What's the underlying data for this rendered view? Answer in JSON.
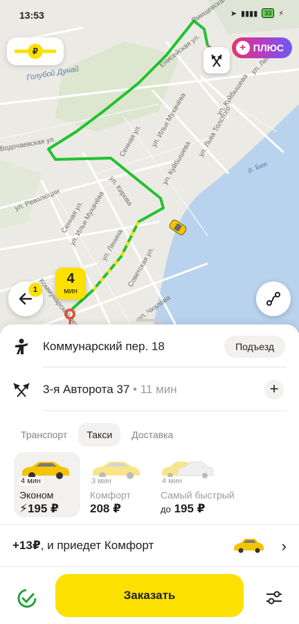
{
  "status_bar": {
    "time": "13:53",
    "battery": "33"
  },
  "map": {
    "district": "Голубой Дунай",
    "river": "р. Бия",
    "streets": [
      "Ямищевская ул.",
      "Енисейская ул.",
      "Водочаевская ул.",
      "ул. Революции",
      "Сенная ул.",
      "ул. Ильи Мухачёва",
      "ул. Куйбышева",
      "ул. Льва Толстого",
      "ул. Кирова",
      "Советская ул.",
      "ул. Ленина",
      "ул. Чкалова",
      "Коммунарский пер.",
      "ул. Ильи Мухачёва",
      "Сенная ул.",
      "ул. Ленина",
      "ул. Куйбышева"
    ],
    "plus_label": "ПЛЮС",
    "eta": {
      "value": "4",
      "unit": "мин"
    },
    "badge_count": "1"
  },
  "route": {
    "from": "Коммунарский пер. 18",
    "entrance_label": "Подъезд",
    "to": "3-я Авторота 37",
    "to_eta": "11 мин"
  },
  "tabs": [
    {
      "label": "Транспорт",
      "active": false
    },
    {
      "label": "Такси",
      "active": true
    },
    {
      "label": "Доставка",
      "active": false
    }
  ],
  "tariffs": [
    {
      "time": "4 мин",
      "name": "Эконом",
      "price": "195 ₽",
      "prefix": "",
      "selected": true
    },
    {
      "time": "3 мин",
      "name": "Комфорт",
      "price": "208 ₽",
      "prefix": "",
      "selected": false
    },
    {
      "time": "4 мин",
      "name": "Самый быстрый",
      "price": "195 ₽",
      "prefix": "до",
      "selected": false
    }
  ],
  "upsell": {
    "amount": "+13₽",
    "text": ", и приедет Комфорт"
  },
  "order_button": "Заказать",
  "colors": {
    "accent": "#fce000",
    "route": "#21c230",
    "water": "#b9d2ee"
  }
}
